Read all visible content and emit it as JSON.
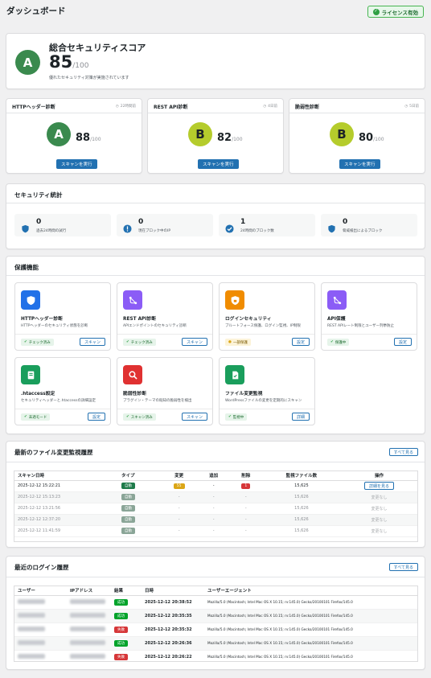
{
  "header": {
    "title": "ダッシュボード",
    "license_label": "ライセンス有効"
  },
  "overall": {
    "title": "総合セキュリティスコア",
    "grade": "A",
    "score": "85",
    "max": "/100",
    "message": "優れたセキュリティ対策が実施されています"
  },
  "scans": [
    {
      "title": "HTTPヘッダー診断",
      "time": "22時間前",
      "grade": "A",
      "score": "88",
      "max": "/100",
      "button": "スキャンを実行"
    },
    {
      "title": "REST API診断",
      "time": "4日前",
      "grade": "B",
      "score": "82",
      "max": "/100",
      "button": "スキャンを実行"
    },
    {
      "title": "脆弱性診断",
      "time": "5日前",
      "grade": "B",
      "score": "80",
      "max": "/100",
      "button": "スキャンを実行"
    }
  ],
  "stats": {
    "title": "セキュリティ統計",
    "items": [
      {
        "value": "0",
        "label": "過去24時間の試行",
        "icon": "shield-icon"
      },
      {
        "value": "0",
        "label": "現在ブロック中のIP",
        "icon": "alert-icon"
      },
      {
        "value": "1",
        "label": "24時間のブロック数",
        "icon": "check-icon"
      },
      {
        "value": "0",
        "label": "脅威検出によるブロック",
        "icon": "shield-icon"
      }
    ]
  },
  "features": {
    "title": "保護機能",
    "items": [
      {
        "name": "HTTPヘッダー診断",
        "desc": "HTTPヘッダーのセキュリティ状態を診断",
        "status": "チェック済み",
        "action": "スキャン",
        "icon": "shield-icon",
        "color": "#2271e8"
      },
      {
        "name": "REST API診断",
        "desc": "APIエンドポイントのセキュリティ診断",
        "status": "チェック済み",
        "action": "スキャン",
        "icon": "branch-icon",
        "color": "#8b5cf6"
      },
      {
        "name": "ログインセキュリティ",
        "desc": "ブルートフォース保護、ログイン監視、IP制限",
        "status": "一部保護",
        "action": "設定",
        "icon": "lock-shield-icon",
        "color": "#f08c00"
      },
      {
        "name": "API保護",
        "desc": "REST APIレート制限とユーザー列挙防止",
        "status": "保護中",
        "action": "設定",
        "icon": "branch-icon",
        "color": "#8b5cf6"
      },
      {
        "name": ".htaccess設定",
        "desc": "セキュリティヘッダーと.htaccessの詳細設定",
        "status": "未適モード",
        "action": "設定",
        "icon": "file-icon",
        "color": "#1a9e5c"
      },
      {
        "name": "脆弱性診断",
        "desc": "プラグイン・テーマの既知の脆弱性を検出",
        "status": "スキャン済み",
        "action": "スキャン",
        "icon": "search-icon",
        "color": "#e03131"
      },
      {
        "name": "ファイル変更監視",
        "desc": "WordPressファイルの変更を定期的にスキャン",
        "status": "監視中",
        "action": "詳細",
        "icon": "doc-icon",
        "color": "#1a9e5c"
      }
    ]
  },
  "file_history": {
    "title": "最新のファイル変更監視履歴",
    "see_all": "すべて見る",
    "columns": [
      "スキャン日時",
      "タイプ",
      "変更",
      "追加",
      "削除",
      "監視ファイル数",
      "操作"
    ],
    "rows": [
      {
        "date": "2025-12-12 15:22:21",
        "type": "自動",
        "changed": "55",
        "added": "-",
        "deleted": "1",
        "files": "15,625",
        "action": "詳細を見る",
        "dim": false
      },
      {
        "date": "2025-12-12 15:13:23",
        "type": "自動",
        "changed": "-",
        "added": "-",
        "deleted": "-",
        "files": "15,626",
        "action": "変更なし",
        "dim": true
      },
      {
        "date": "2025-12-12 13:21:56",
        "type": "自動",
        "changed": "-",
        "added": "-",
        "deleted": "-",
        "files": "15,626",
        "action": "変更なし",
        "dim": true
      },
      {
        "date": "2025-12-12 12:37:20",
        "type": "自動",
        "changed": "-",
        "added": "-",
        "deleted": "-",
        "files": "15,626",
        "action": "変更なし",
        "dim": true
      },
      {
        "date": "2025-12-12 11:41:59",
        "type": "自動",
        "changed": "-",
        "added": "-",
        "deleted": "-",
        "files": "15,626",
        "action": "変更なし",
        "dim": true
      }
    ]
  },
  "login_history": {
    "title": "最近のログイン履歴",
    "see_all": "すべて見る",
    "columns": [
      "ユーザー",
      "IPアドレス",
      "結果",
      "日時",
      "ユーザーエージェント"
    ],
    "rows": [
      {
        "result": "成功",
        "ok": true,
        "date": "2025-12-12 20:38:52",
        "ua": "Mozilla/5.0 (Macintosh; Intel Mac OS X 10.15; rv:145.0) Gecko/20100101 Firefox/145.0"
      },
      {
        "result": "成功",
        "ok": true,
        "date": "2025-12-12 20:35:35",
        "ua": "Mozilla/5.0 (Macintosh; Intel Mac OS X 10.15; rv:145.0) Gecko/20100101 Firefox/145.0"
      },
      {
        "result": "失敗",
        "ok": false,
        "date": "2025-12-12 20:35:32",
        "ua": "Mozilla/5.0 (Macintosh; Intel Mac OS X 10.15; rv:145.0) Gecko/20100101 Firefox/145.0"
      },
      {
        "result": "成功",
        "ok": true,
        "date": "2025-12-12 20:26:36",
        "ua": "Mozilla/5.0 (Macintosh; Intel Mac OS X 10.15; rv:145.0) Gecko/20100101 Firefox/145.0"
      },
      {
        "result": "失敗",
        "ok": false,
        "date": "2025-12-12 20:26:22",
        "ua": "Mozilla/5.0 (Macintosh; Intel Mac OS X 10.15; rv:145.0) Gecko/20100101 Firefox/145.0"
      }
    ]
  }
}
